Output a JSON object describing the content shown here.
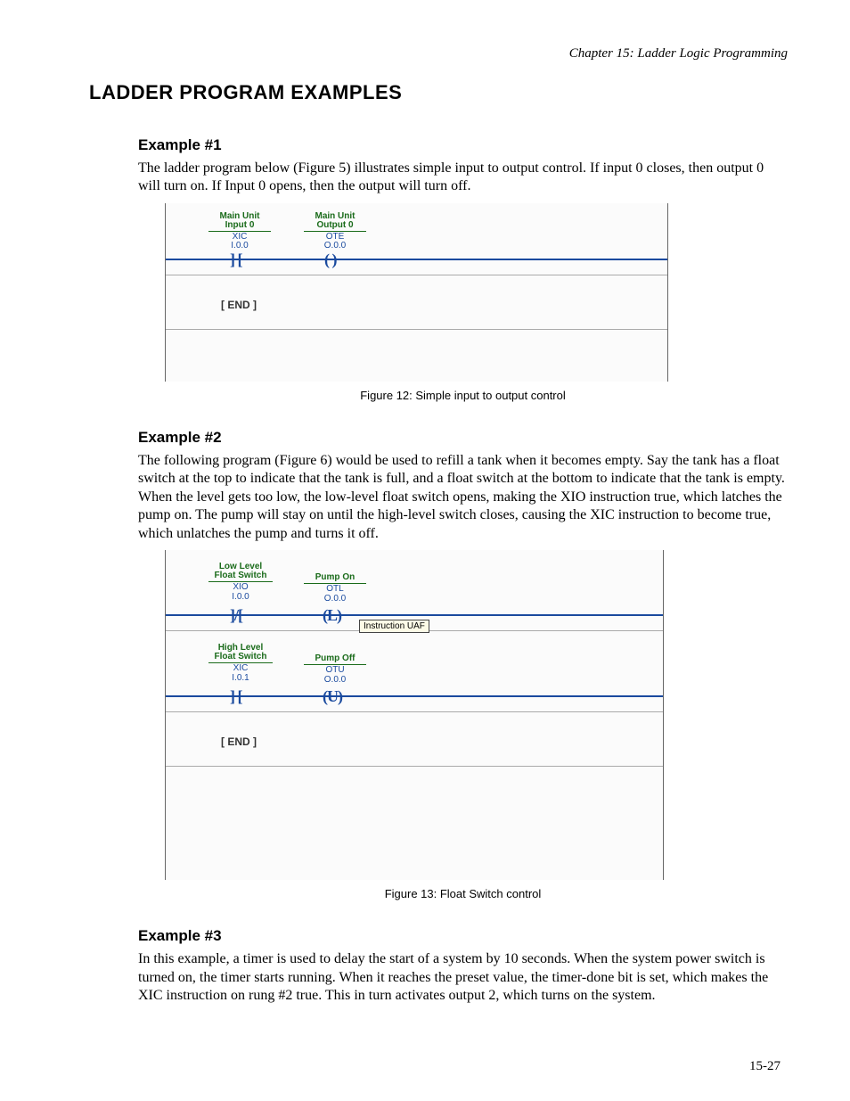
{
  "header": {
    "chapter": "Chapter 15: Ladder Logic Programming"
  },
  "heading": "LADDER PROGRAM EXAMPLES",
  "ex1": {
    "title": "Example #1",
    "body": "The ladder program below (Figure 5) illustrates simple input to output control.  If input 0 closes, then output 0 will turn on.  If Input 0 opens, then the output will turn off.",
    "caption": "Figure 12: Simple input to output control",
    "rung1": {
      "in": {
        "t1": "Main Unit",
        "t2": "Input 0",
        "code1": "XIC",
        "code2": "I.0.0",
        "sym": "] ["
      },
      "out": {
        "t1": "Main Unit",
        "t2": "Output 0",
        "code1": "OTE",
        "code2": "O.0.0",
        "sym": "( )"
      }
    },
    "end": "[ END ]"
  },
  "ex2": {
    "title": "Example #2",
    "body": "The following program (Figure 6) would be used to refill a tank when it becomes empty.  Say the tank has a float switch at the top to indicate that the tank is full, and a float switch at the bottom to indicate that the tank is empty.  When the level gets too low, the low-level float switch opens, making the XIO instruction true, which latches the pump on.  The pump will stay on until the high-level switch closes, causing the XIC instruction to become true, which unlatches the pump and turns it off.",
    "caption": "Figure 13: Float Switch control",
    "rung1": {
      "in": {
        "t1": "Low Level",
        "t2": "Float Switch",
        "code1": "XIO",
        "code2": "I.0.0",
        "sym": "]/["
      },
      "out": {
        "t1": "Pump On",
        "t2": "",
        "code1": "OTL",
        "code2": "O.0.0",
        "sym": "(L)"
      },
      "tooltip": "Instruction UAF"
    },
    "rung2": {
      "in": {
        "t1": "High Level",
        "t2": "Float Switch",
        "code1": "XIC",
        "code2": "I.0.1",
        "sym": "] ["
      },
      "out": {
        "t1": "Pump Off",
        "t2": "",
        "code1": "OTU",
        "code2": "O.0.0",
        "sym": "(U)"
      }
    },
    "end": "[ END ]"
  },
  "ex3": {
    "title": "Example #3",
    "body": "In this example, a timer is used to delay the start of a system by 10 seconds.  When the system power switch is turned on, the timer starts running.  When it reaches the preset value, the timer-done bit is set, which makes the XIC instruction on rung #2 true.  This in turn activates output 2, which turns on the system."
  },
  "page": "15-27"
}
